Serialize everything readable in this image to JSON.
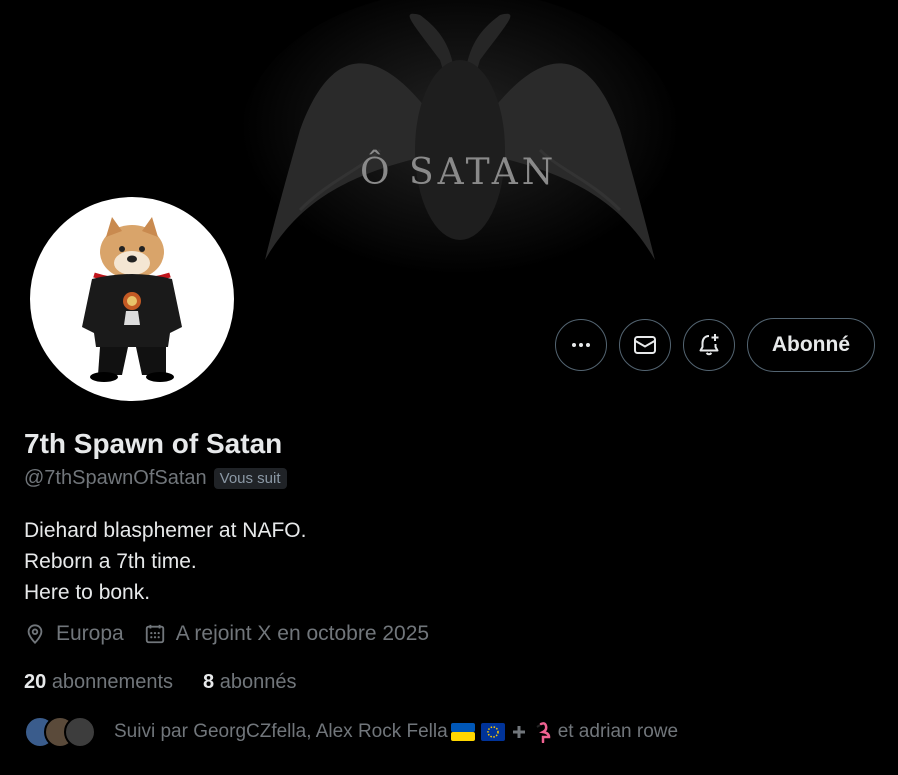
{
  "banner": {
    "text": "Ô SATAN"
  },
  "actions": {
    "follow_label": "Abonné"
  },
  "profile": {
    "name": "7th Spawn of Satan",
    "handle": "@7thSpawnOfSatan",
    "follows_you": "Vous suit",
    "bio": [
      "Diehard blasphemer at NAFO.",
      "Reborn a 7th time.",
      "Here to bonk."
    ],
    "location": "Europa",
    "joined": "A rejoint X en octobre 2025",
    "following_count": "20",
    "following_label": "abonnements",
    "followers_count": "8",
    "followers_label": "abonnés"
  },
  "followed_by": {
    "prefix": "Suivi par GeorgCZfella, Alex Rock Fella",
    "suffix": "et adrian rowe"
  },
  "icons": {
    "more": "more-icon",
    "message": "envelope-icon",
    "notify": "bell-plus-icon",
    "location": "location-pin-icon",
    "calendar": "calendar-icon"
  },
  "colors": {
    "text": "#e7e9ea",
    "secondary": "#71767b",
    "border": "#536471",
    "bg": "#000000"
  }
}
